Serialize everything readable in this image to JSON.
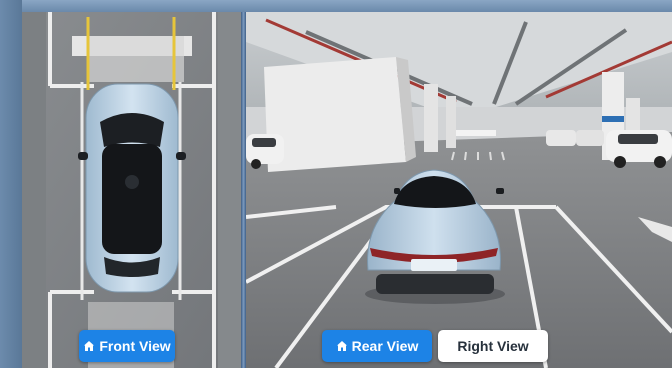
{
  "colors": {
    "button_active": "#1d83e6",
    "button_inactive": "#ffffff",
    "car_body": "#bcd3e6",
    "frame": "#5e7e9f"
  },
  "buttons": {
    "front_view": {
      "label": "Front View",
      "icon": "home-icon",
      "active": true
    },
    "rear_view": {
      "label": "Rear View",
      "icon": "home-icon",
      "active": true
    },
    "right_view": {
      "label": "Right View",
      "active": false
    }
  }
}
